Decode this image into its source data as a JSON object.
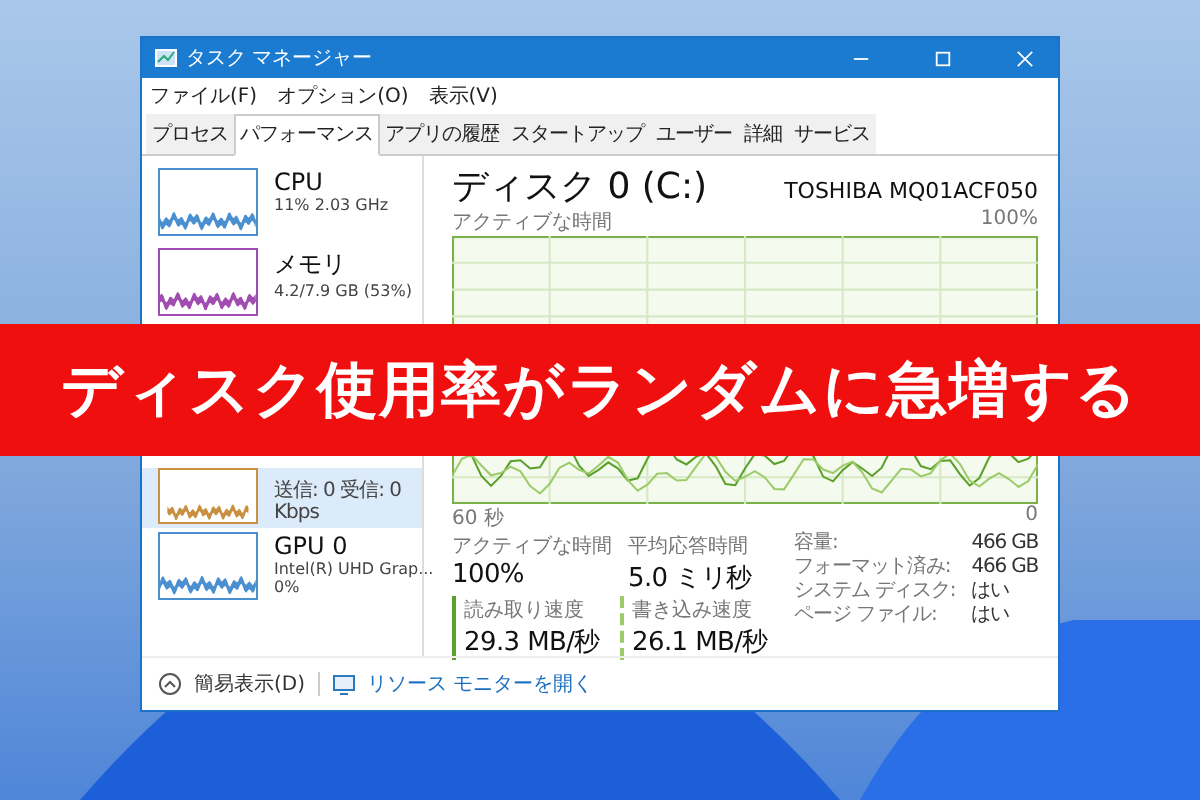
{
  "window": {
    "title": "タスク マネージャー"
  },
  "menu": [
    "ファイル(F)",
    "オプション(O)",
    "表示(V)"
  ],
  "tabs": [
    {
      "label": "プロセス",
      "selected": false
    },
    {
      "label": "パフォーマンス",
      "selected": true
    },
    {
      "label": "アプリの履歴",
      "selected": false
    },
    {
      "label": "スタートアップ",
      "selected": false
    },
    {
      "label": "ユーザー",
      "selected": false
    },
    {
      "label": "詳細",
      "selected": false
    },
    {
      "label": "サービス",
      "selected": false
    }
  ],
  "sidebar": {
    "items": [
      {
        "name": "CPU",
        "detail": "11% 2.03 GHz",
        "color": "#4a90d0",
        "selected": false
      },
      {
        "name": "メモリ",
        "detail": "4.2/7.9 GB (53%)",
        "color": "#a04cb0",
        "selected": false
      },
      {
        "detail": "送信: 0 受信: 0 Kbps",
        "color": "#c89040",
        "selected": true
      },
      {
        "name": "GPU 0",
        "detail": "Intel(R) UHD Grap...",
        "detail2": "0%",
        "color": "#4a90d0",
        "selected": false
      }
    ]
  },
  "panel": {
    "title": "ディスク 0 (C:)",
    "model": "TOSHIBA MQ01ACF050",
    "graph_label": "アクティブな時間",
    "graph_max": "100%",
    "graph_time": "60 秒",
    "graph_min": "0",
    "stats": [
      {
        "label": "アクティブな時間",
        "value": "100%"
      },
      {
        "label": "平均応答時間",
        "value": "5.0 ミリ秒"
      }
    ],
    "speeds": [
      {
        "kind": "read",
        "label": "読み取り速度",
        "value": "29.3 MB/秒"
      },
      {
        "kind": "write",
        "label": "書き込み速度",
        "value": "26.1 MB/秒"
      }
    ],
    "properties": [
      {
        "label": "容量:",
        "value": "466 GB"
      },
      {
        "label": "フォーマット済み:",
        "value": "466 GB"
      },
      {
        "label": "システム ディスク:",
        "value": "はい"
      },
      {
        "label": "ページ ファイル:",
        "value": "はい"
      }
    ]
  },
  "footer": {
    "fewer_details": "簡易表示(D)",
    "resource_monitor": "リソース モニターを開く"
  },
  "banner": "ディスク使用率がランダムに急増する"
}
